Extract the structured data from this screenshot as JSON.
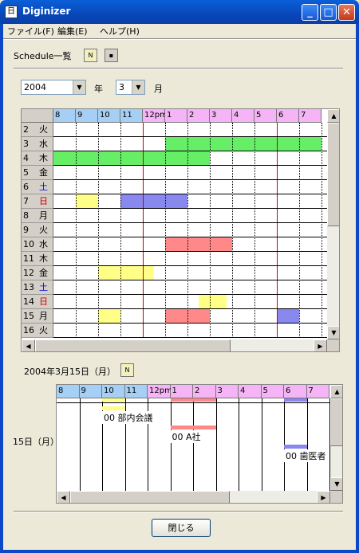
{
  "window": {
    "title": "Diginizer",
    "icon_text": "日"
  },
  "menu": [
    "ファイル(F)",
    "編集(E)",
    "ヘルプ(H)"
  ],
  "schedule": {
    "label": "Schedule一覧"
  },
  "selector": {
    "year": "2004",
    "year_unit": "年",
    "month": "3",
    "month_unit": "月"
  },
  "hours": [
    "8",
    "9",
    "10",
    "11",
    "12pm",
    "1",
    "2",
    "3",
    "4",
    "5",
    "6",
    "7"
  ],
  "rows": [
    {
      "d": "2",
      "w": "火",
      "type": "weekday"
    },
    {
      "d": "3",
      "w": "水",
      "type": "weekday"
    },
    {
      "d": "4",
      "w": "木",
      "type": "weekday"
    },
    {
      "d": "5",
      "w": "金",
      "type": "weekday"
    },
    {
      "d": "6",
      "w": "土",
      "type": "sat"
    },
    {
      "d": "7",
      "w": "日",
      "type": "sun"
    },
    {
      "d": "8",
      "w": "月",
      "type": "weekday"
    },
    {
      "d": "9",
      "w": "火",
      "type": "weekday"
    },
    {
      "d": "10",
      "w": "水",
      "type": "weekday"
    },
    {
      "d": "11",
      "w": "木",
      "type": "weekday"
    },
    {
      "d": "12",
      "w": "金",
      "type": "weekday"
    },
    {
      "d": "13",
      "w": "土",
      "type": "sat"
    },
    {
      "d": "14",
      "w": "日",
      "type": "sun"
    },
    {
      "d": "15",
      "w": "月",
      "type": "weekday"
    },
    {
      "d": "16",
      "w": "火",
      "type": "weekday"
    }
  ],
  "colors": {
    "morning_header": "#a6cff5",
    "afternoon_header": "#f5b4f5",
    "green": "#66ee66",
    "yellow": "#ffff88",
    "blue": "#8888ee",
    "red": "#ff8888",
    "sat": "#0000cc",
    "sun": "#cc0000"
  },
  "events": [
    {
      "row": 1,
      "start": 13,
      "end": 20,
      "color": "green"
    },
    {
      "row": 2,
      "start": 8,
      "end": 15,
      "color": "green"
    },
    {
      "row": 5,
      "start": 9,
      "end": 10,
      "color": "yellow"
    },
    {
      "row": 5,
      "start": 11,
      "end": 14,
      "color": "blue"
    },
    {
      "row": 8,
      "start": 13,
      "end": 16,
      "color": "red"
    },
    {
      "row": 10,
      "start": 10,
      "end": 12.5,
      "color": "yellow"
    },
    {
      "row": 12,
      "start": 14.5,
      "end": 15.75,
      "color": "yellow"
    },
    {
      "row": 13,
      "start": 10,
      "end": 11,
      "color": "yellow"
    },
    {
      "row": 13,
      "start": 13,
      "end": 15,
      "color": "red"
    },
    {
      "row": 13,
      "start": 18,
      "end": 19,
      "color": "blue"
    }
  ],
  "detail": {
    "date_label": "2004年3月15日（月）",
    "day_label": "15日（月）",
    "events": [
      {
        "start": 10,
        "end": 11,
        "color": "yellow",
        "text": "00  部内会議",
        "lane": 0
      },
      {
        "start": 13,
        "end": 15,
        "color": "red",
        "text": "00  A社",
        "lane": 1
      },
      {
        "start": 18,
        "end": 19,
        "color": "blue",
        "text": "00  歯医者",
        "lane": 2
      }
    ]
  },
  "close_button": "閉じる"
}
